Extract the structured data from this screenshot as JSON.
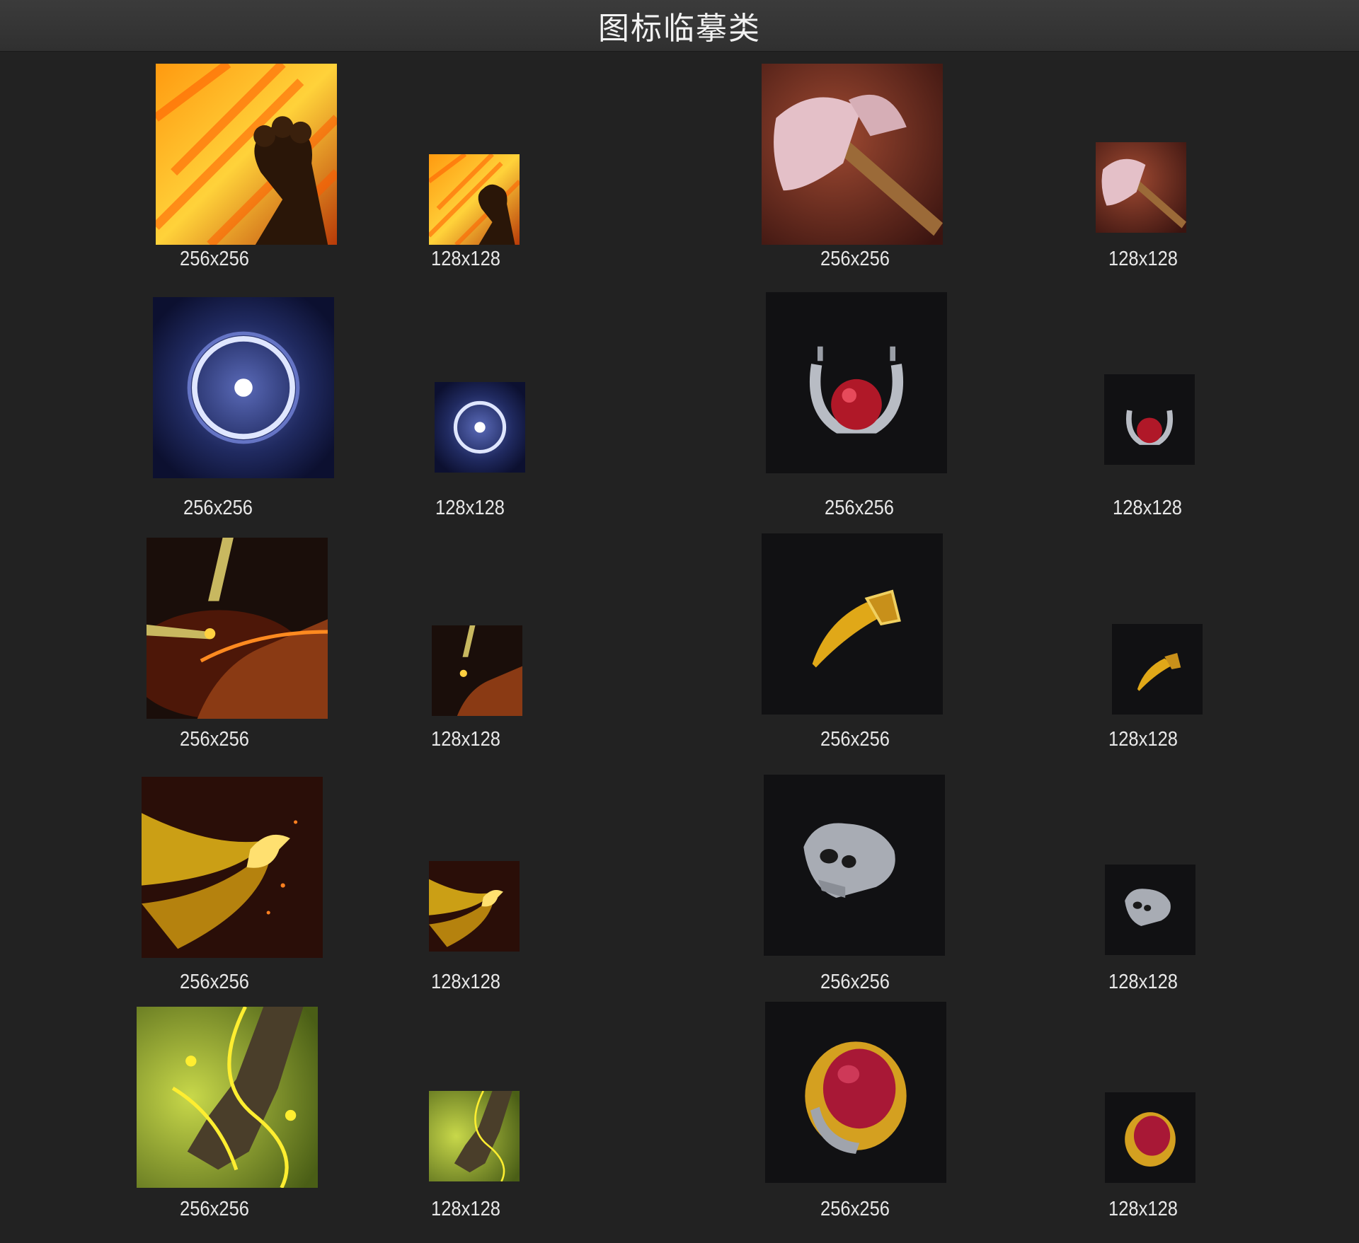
{
  "header": {
    "title": "图标临摹类"
  },
  "icons": [
    {
      "subject": "flaming-fist",
      "large_label": "256x256",
      "small_label": "128x128"
    },
    {
      "subject": "battle-axe",
      "large_label": "256x256",
      "small_label": "128x128"
    },
    {
      "subject": "energy-orb",
      "large_label": "256x256",
      "small_label": "128x128"
    },
    {
      "subject": "ruby-amulet",
      "large_label": "256x256",
      "small_label": "128x128"
    },
    {
      "subject": "sword-strike-boot",
      "large_label": "256x256",
      "small_label": "128x128"
    },
    {
      "subject": "golden-fang",
      "large_label": "256x256",
      "small_label": "128x128"
    },
    {
      "subject": "golden-phoenix",
      "large_label": "256x256",
      "small_label": "128x128"
    },
    {
      "subject": "skull-ring",
      "large_label": "256x256",
      "small_label": "128x128"
    },
    {
      "subject": "vine-tree-claw",
      "large_label": "256x256",
      "small_label": "128x128"
    },
    {
      "subject": "ruby-gold-ring",
      "large_label": "256x256",
      "small_label": "128x128"
    }
  ]
}
